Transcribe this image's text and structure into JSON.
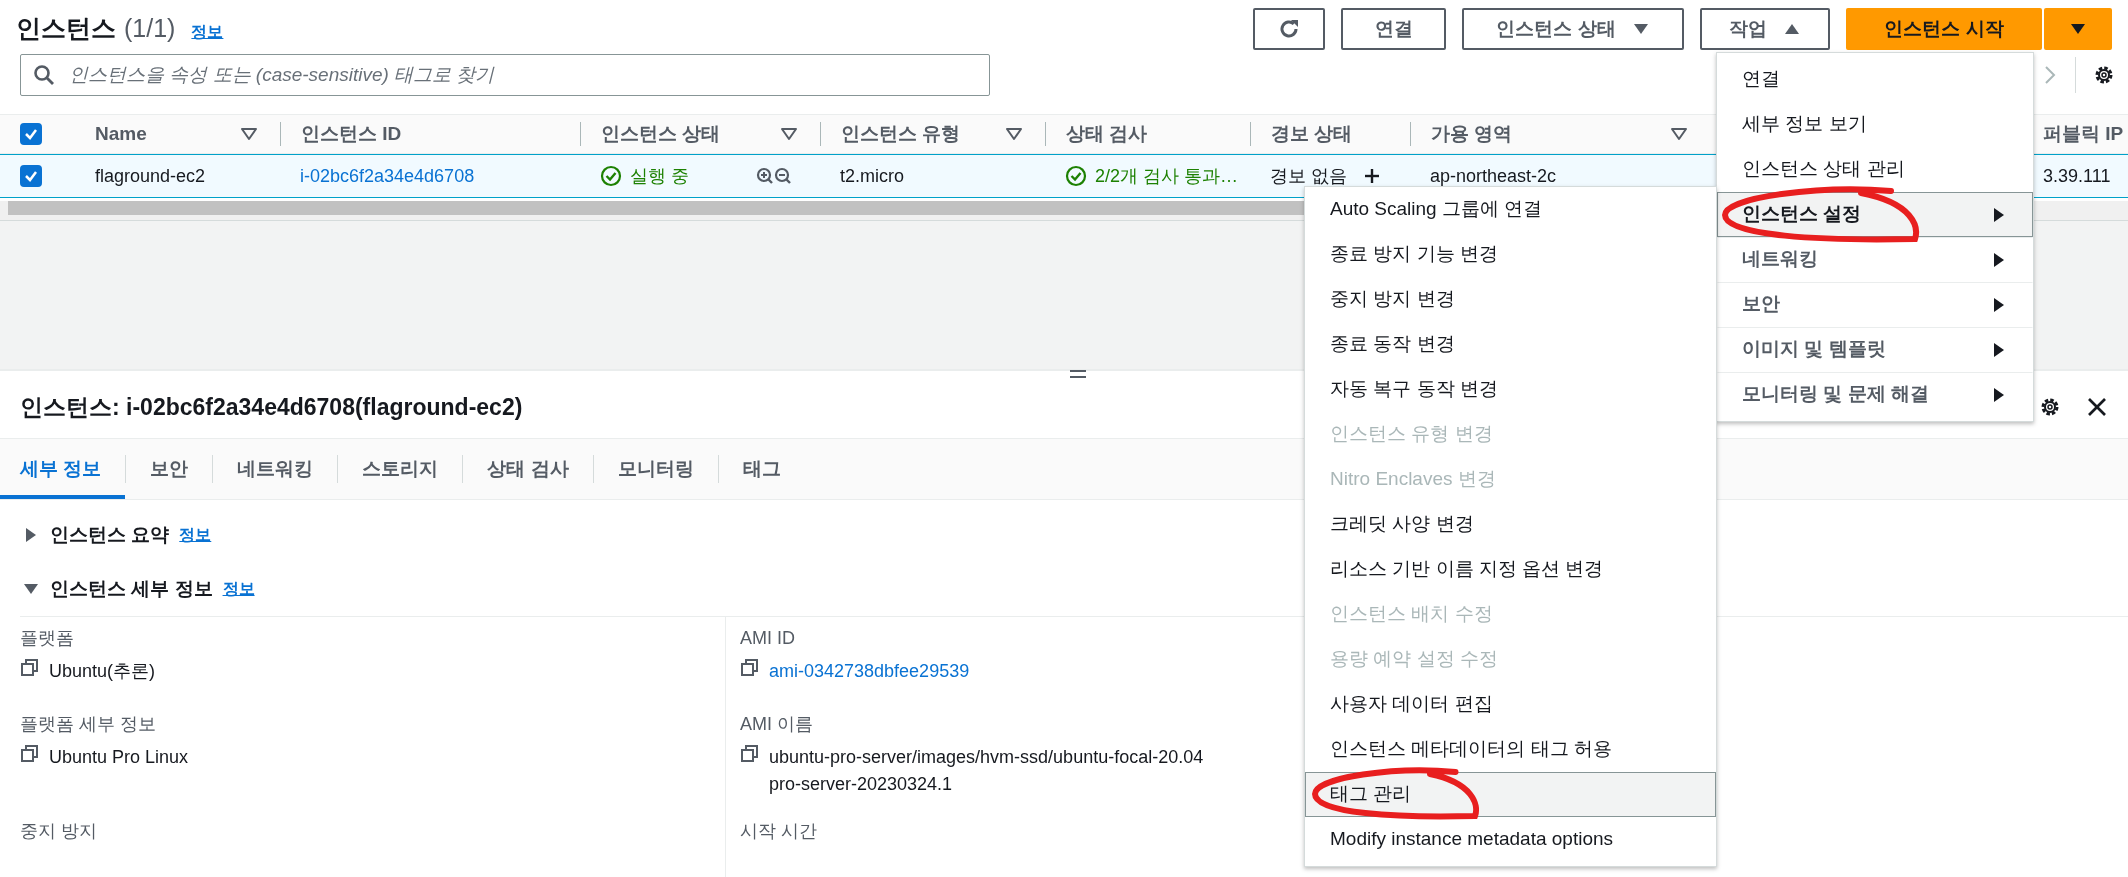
{
  "header": {
    "title": "인스턴스",
    "count": "(1/1)",
    "info": "정보"
  },
  "buttons": [
    {
      "kind": "refresh"
    },
    {
      "kind": "plain",
      "label": "연결"
    },
    {
      "kind": "dropdown",
      "label": "인스턴스 상태",
      "expanded": false
    },
    {
      "kind": "dropdown",
      "label": "작업",
      "expanded": true
    },
    {
      "kind": "primary",
      "label": "인스턴스 시작"
    },
    {
      "kind": "split"
    }
  ],
  "search": {
    "placeholder": "인스턴스을 속성 또는 (case-sensitive) 태그로 찾기"
  },
  "table": {
    "all_selected": true,
    "columns": [
      {
        "label": "Name",
        "sortable": true
      },
      {
        "label": "인스턴스 ID"
      },
      {
        "label": "인스턴스 상태",
        "sortable": true
      },
      {
        "label": "인스턴스 유형",
        "sortable": true
      },
      {
        "label": "상태 검사"
      },
      {
        "label": "경보 상태"
      },
      {
        "label": "가용 영역",
        "sortable": true
      },
      {
        "label": "퍼블릭 IP"
      }
    ],
    "rows": [
      {
        "selected": true,
        "name": "flaground-ec2",
        "instance_id": "i-02bc6f2a34e4d6708",
        "state": "실행 중",
        "type": "t2.micro",
        "status_check": "2/2개 검사 통과…",
        "alarm": "경보 없음",
        "zone": "ap-northeast-2c",
        "public_ip": "3.39.111"
      }
    ]
  },
  "details": {
    "title": "인스턴스: i-02bc6f2a34e4d6708(flaground-ec2)",
    "tabs": [
      {
        "label": "세부 정보",
        "selected": true
      },
      {
        "label": "보안",
        "selected": false
      },
      {
        "label": "네트워킹",
        "selected": false
      },
      {
        "label": "스토리지",
        "selected": false
      },
      {
        "label": "상태 검사",
        "selected": false
      },
      {
        "label": "모니터링",
        "selected": false
      },
      {
        "label": "태그",
        "selected": false
      }
    ],
    "sections": [
      {
        "title": "인스턴스 요약",
        "info": "정보",
        "expanded": false
      },
      {
        "title": "인스턴스 세부 정보",
        "info": "정보",
        "expanded": true
      }
    ],
    "fields": [
      {
        "label": "플랫폼",
        "value": [
          "Ubuntu(추론)"
        ],
        "link": false
      },
      {
        "label": "AMI ID",
        "value": [
          "ami-0342738dbfee29539"
        ],
        "link": true
      },
      {
        "label": "플랫폼 세부 정보",
        "value": [
          "Ubuntu Pro Linux"
        ],
        "link": false
      },
      {
        "label": "AMI 이름",
        "value": [
          "ubuntu-pro-server/images/hvm-ssd/ubuntu-focal-20.04",
          "pro-server-20230324.1"
        ],
        "link": false
      },
      {
        "label": "중지 방지"
      },
      {
        "label": "시작 시간"
      }
    ]
  },
  "actions_menu": [
    {
      "label": "연결",
      "kind": "item",
      "highlighted": false,
      "circled": false
    },
    {
      "label": "세부 정보 보기",
      "kind": "item",
      "highlighted": false,
      "circled": false
    },
    {
      "label": "인스턴스 상태 관리",
      "kind": "item",
      "highlighted": false,
      "circled": false
    },
    {
      "label": "인스턴스 설정",
      "kind": "submenu",
      "highlighted": true,
      "circled": true
    },
    {
      "label": "네트워킹",
      "kind": "submenu",
      "highlighted": false,
      "circled": false
    },
    {
      "label": "보안",
      "kind": "submenu",
      "highlighted": false,
      "circled": false
    },
    {
      "label": "이미지 및 템플릿",
      "kind": "submenu",
      "highlighted": false,
      "circled": false
    },
    {
      "label": "모니터링 및 문제 해결",
      "kind": "submenu",
      "highlighted": false,
      "circled": false
    }
  ],
  "settings_submenu": [
    {
      "label": "Auto Scaling 그룹에 연결",
      "disabled": false,
      "highlighted": false,
      "circled": false
    },
    {
      "label": "종료 방지 기능 변경",
      "disabled": false,
      "highlighted": false,
      "circled": false
    },
    {
      "label": "중지 방지 변경",
      "disabled": false,
      "highlighted": false,
      "circled": false
    },
    {
      "label": "종료 동작 변경",
      "disabled": false,
      "highlighted": false,
      "circled": false
    },
    {
      "label": "자동 복구 동작 변경",
      "disabled": false,
      "highlighted": false,
      "circled": false
    },
    {
      "label": "인스턴스 유형 변경",
      "disabled": true,
      "highlighted": false,
      "circled": false
    },
    {
      "label": "Nitro Enclaves 변경",
      "disabled": true,
      "highlighted": false,
      "circled": false
    },
    {
      "label": "크레딧 사양 변경",
      "disabled": false,
      "highlighted": false,
      "circled": false
    },
    {
      "label": "리소스 기반 이름 지정 옵션 변경",
      "disabled": false,
      "highlighted": false,
      "circled": false
    },
    {
      "label": "인스턴스 배치 수정",
      "disabled": true,
      "highlighted": false,
      "circled": false
    },
    {
      "label": "용량 예약 설정 수정",
      "disabled": true,
      "highlighted": false,
      "circled": false
    },
    {
      "label": "사용자 데이터 편집",
      "disabled": false,
      "highlighted": false,
      "circled": false
    },
    {
      "label": "인스턴스 메타데이터의 태그 허용",
      "disabled": false,
      "highlighted": false,
      "circled": false
    },
    {
      "label": "태그 관리",
      "disabled": false,
      "highlighted": true,
      "circled": true
    },
    {
      "label": "Modify instance metadata options",
      "disabled": false,
      "highlighted": false,
      "circled": false
    }
  ]
}
